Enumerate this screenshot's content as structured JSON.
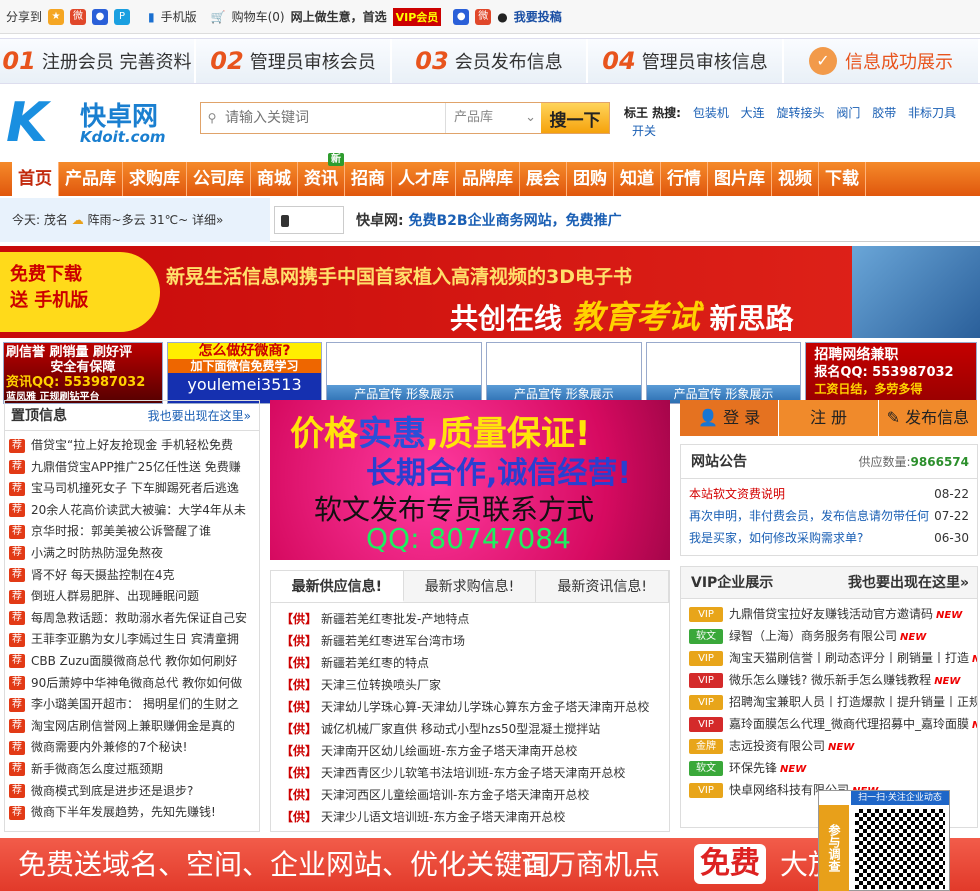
{
  "topbar": {
    "share": "分享到",
    "mobile": "手机版",
    "cart": "购物车(0)",
    "biz": "网上做生意，首选",
    "vip": "VIP会员",
    "submit": "我要投稿"
  },
  "steps": [
    {
      "num": "01",
      "label": "注册会员 完善资料"
    },
    {
      "num": "02",
      "label": "管理员审核会员"
    },
    {
      "num": "03",
      "label": "会员发布信息"
    },
    {
      "num": "04",
      "label": "管理员审核信息"
    },
    {
      "label": "信息成功展示"
    }
  ],
  "logo": {
    "cn": "快卓网",
    "en": "Kdoit.com"
  },
  "search": {
    "placeholder": "请输入关键词",
    "category": "产品库",
    "button": "搜一下"
  },
  "hot": {
    "prefix": "标王 热搜:",
    "items": [
      "包装机",
      "大连",
      "旋转接头",
      "阀门",
      "胶带",
      "非标刀具",
      "开关"
    ]
  },
  "nav": [
    {
      "label": "首页"
    },
    {
      "label": "产品库"
    },
    {
      "label": "求购库"
    },
    {
      "label": "公司库"
    },
    {
      "label": "商城"
    },
    {
      "label": "资讯",
      "badge": "新"
    },
    {
      "label": "招商"
    },
    {
      "label": "人才库"
    },
    {
      "label": "品牌库"
    },
    {
      "label": "展会"
    },
    {
      "label": "团购"
    },
    {
      "label": "知道"
    },
    {
      "label": "行情"
    },
    {
      "label": "图片库"
    },
    {
      "label": "视频"
    },
    {
      "label": "下载"
    }
  ],
  "info": {
    "today": "今天:",
    "city": "茂名",
    "weather": "阵雨~多云 31℃~",
    "detail": "详细»",
    "site": "快卓网:",
    "slogan": "免费B2B企业商务网站，免费推广"
  },
  "banner": {
    "download": "免费下载",
    "send": "送 手机版",
    "title": "新晃生活信息网携手中国首家植入高清视频的3D电子书",
    "slogan_a": "共创在线",
    "slogan_b": "教育考试",
    "slogan_c": "新思路"
  },
  "ads": {
    "ad1": [
      "刷信誉 刷销量 刷好评",
      "安全有保障",
      "资讯QQ: 553987032",
      "蓝凤雅 正规刷钻平台"
    ],
    "ad2": {
      "top": "怎么做好微商?",
      "mid": "加下面微信免费学习",
      "name": "youlemei3513"
    },
    "empty": "产品宣传 形象展示",
    "ad6": {
      "title": "招聘网络兼职",
      "qq": "报名QQ: 553987032",
      "sub": "工资日结，多劳多得"
    }
  },
  "featured": {
    "title": "置顶信息",
    "link": "我也要出现在这里»",
    "tag": "荐",
    "items": [
      "借贷宝“拉上好友抢现金 手机轻松免费",
      "九鼎借贷宝APP推广25亿任性送 免费赚",
      "宝马司机撞死女子 下车脚踢死者后逃逸",
      "20余人花高价读武大被骗：大学4年从未",
      "京华时报：郭美美被公诉警醒了谁",
      "小满之时防热防湿免熬夜",
      "肾不好 每天摄盐控制在4克",
      "倒班人群易肥胖、出现睡眠问题",
      "每周急救话题：救助溺水者先保证自己安",
      "王菲李亚鹏为女儿李嫣过生日 宾清童拥",
      "CBB Zuzu面膜微商总代 教你如何刷好",
      "90后萧婷中华神龟微商总代 教你如何做",
      "李小璐美国开超市： 揭明星们的生财之",
      "淘宝网店刷信誉网上兼职赚佣金是真的",
      "微商需要内外兼修的7个秘诀!",
      "新手微商怎么度过瓶颈期",
      "微商模式到底是进步还是退步?",
      "微商下半年发展趋势，先知先赚钱!"
    ]
  },
  "promo": {
    "l1a": "价格",
    "l1b": "实惠",
    "l1c": ",质量保证!",
    "l2": "长期合作,诚信经营!",
    "l3": "软文发布专员联系方式",
    "l4": "QQ: 80747084"
  },
  "supply": {
    "tabs": [
      "最新供应信息!",
      "最新求购信息!",
      "最新资讯信息!"
    ],
    "tag": "【供】",
    "items": [
      "新疆若羌红枣批发-产地特点",
      "新疆若羌红枣进军台湾市场",
      "新疆若羌红枣的特点",
      "天津三位转换喷头厂家",
      "天津幼儿学珠心算-天津幼儿学珠心算东方金子塔天津南开总校",
      "诚亿机械厂家直供 移动式小型hzs50型混凝土搅拌站",
      "天津南开区幼儿绘画班-东方金子塔天津南开总校",
      "天津西青区少儿软笔书法培训班-东方金子塔天津南开总校",
      "天津河西区儿童绘画培训-东方金子塔天津南开总校",
      "天津少儿语文培训班-东方金子塔天津南开总校"
    ]
  },
  "login": {
    "login": "登 录",
    "register": "注 册",
    "publish": "发布信息"
  },
  "notice": {
    "title": "网站公告",
    "count_label": "供应数量:",
    "count": "9866574",
    "items": [
      {
        "text": "本站软文资费说明",
        "date": "08-22",
        "red": true
      },
      {
        "text": "再次申明，非付费会员，发布信息请勿带任何",
        "date": "07-22"
      },
      {
        "text": "我是买家，如何修改采购需求单?",
        "date": "06-30"
      }
    ]
  },
  "vip": {
    "title": "VIP企业展示",
    "link": "我也要出现在这里»",
    "new": "NEW",
    "items": [
      {
        "lv": "VIP",
        "color": "#e8a51a",
        "text": "九鼎借贷宝拉好友赚钱活动官方邀请码"
      },
      {
        "lv": "软文",
        "color": "#3aa83a",
        "text": "绿智（上海）商务服务有限公司"
      },
      {
        "lv": "VIP",
        "color": "#e8a51a",
        "text": "淘宝天猫刷信誉丨刷动态评分丨刷销量丨打造"
      },
      {
        "lv": "VIP",
        "color": "#d42a2a",
        "text": "微乐怎么赚钱? 微乐新手怎么赚钱教程"
      },
      {
        "lv": "VIP",
        "color": "#e8a51a",
        "text": "招聘淘宝兼职人员丨打造爆款丨提升销量丨正规"
      },
      {
        "lv": "VIP",
        "color": "#d42a2a",
        "text": "嘉玲面膜怎么代理_微商代理招募中_嘉玲面膜"
      },
      {
        "lv": "金牌",
        "color": "#e8a51a",
        "text": "志远投资有限公司"
      },
      {
        "lv": "软文",
        "color": "#3aa83a",
        "text": "环保先锋"
      },
      {
        "lv": "VIP",
        "color": "#e8a51a",
        "text": "快卓网络科技有限公司"
      }
    ]
  },
  "footer": {
    "text": "免费送域名、空间、企业网站、优化关键词",
    "text2": "百万商机点",
    "big": "免费",
    "tail": "大放"
  },
  "qr": {
    "side": "参与调查",
    "cap": "扫一扫·关注企业动态"
  }
}
